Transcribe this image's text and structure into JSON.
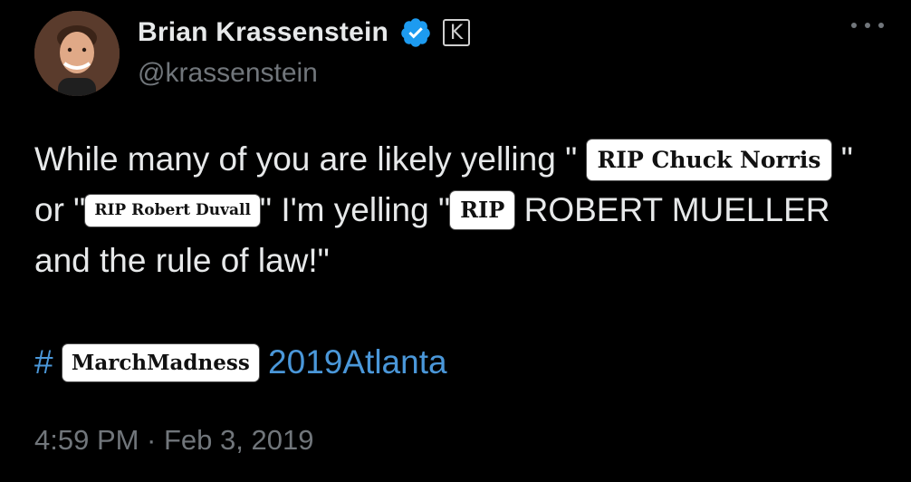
{
  "author": {
    "display_name": "Brian Krassenstein",
    "handle": "@krassenstein",
    "affiliate_badge": "K",
    "verified_color": "#1d9bf0"
  },
  "tweet": {
    "line1_pre": "While many of you are likely yelling \"",
    "line1_sticker": "RIP Chuck Norris",
    "line1_post": "\"",
    "line2_pre": "or \"",
    "line2_sticker_a": "RIP Robert Duvall",
    "line2_mid": "\" I'm yelling \"",
    "line2_sticker_b": "RIP",
    "line2_post": "ROBERT MUELLER",
    "line3": "and the rule of law!\"",
    "hashtag_symbol": "#",
    "hashtag_sticker": "MarchMadness",
    "hashtag_tail": "2019Atlanta",
    "hashtag_color": "#4a97d9"
  },
  "meta": {
    "timestamp": "4:59 PM · Feb 3, 2019"
  },
  "icons": {
    "more": "more-horizontal-icon",
    "verified": "verified-badge-icon",
    "affiliate": "affiliate-k-icon"
  }
}
